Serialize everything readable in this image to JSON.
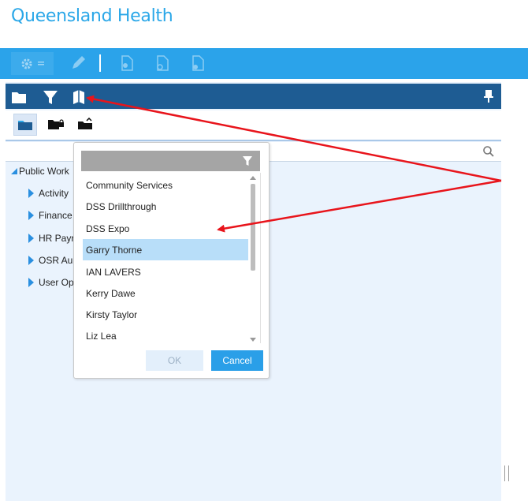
{
  "brand": {
    "title": "Queensland Health"
  },
  "toolbar": {
    "icons": [
      "gear-icon",
      "chevron-down-icon",
      "pencil-icon",
      "document-icon",
      "document-link-icon",
      "document-add-icon"
    ]
  },
  "panel": {
    "header_icons": [
      "folder-icon",
      "filter-icon",
      "book-icon",
      "pin-icon"
    ],
    "tabs": [
      "folder-tab",
      "folder-lock-tab",
      "folder-share-tab"
    ]
  },
  "search": {
    "placeholder": "",
    "value": ""
  },
  "tree": {
    "root": "Public Work",
    "items": [
      "Activity",
      "Finance",
      "HR Payr",
      "OSR Au",
      "User Op"
    ]
  },
  "popup": {
    "items": [
      "Community Services",
      "DSS Drillthrough",
      "DSS Expo",
      "Garry Thorne",
      "IAN LAVERS",
      "Kerry Dawe",
      "Kirsty Taylor",
      "Liz Lea"
    ],
    "selected": "Garry Thorne",
    "ok_label": "OK",
    "cancel_label": "Cancel"
  },
  "colors": {
    "brand": "#2aa7e8",
    "toolbar": "#2ba3ea",
    "panel_header": "#1e5c93",
    "panel_bg": "#eaf3fd",
    "selected": "#b8def9",
    "annotation": "#e8141b"
  }
}
